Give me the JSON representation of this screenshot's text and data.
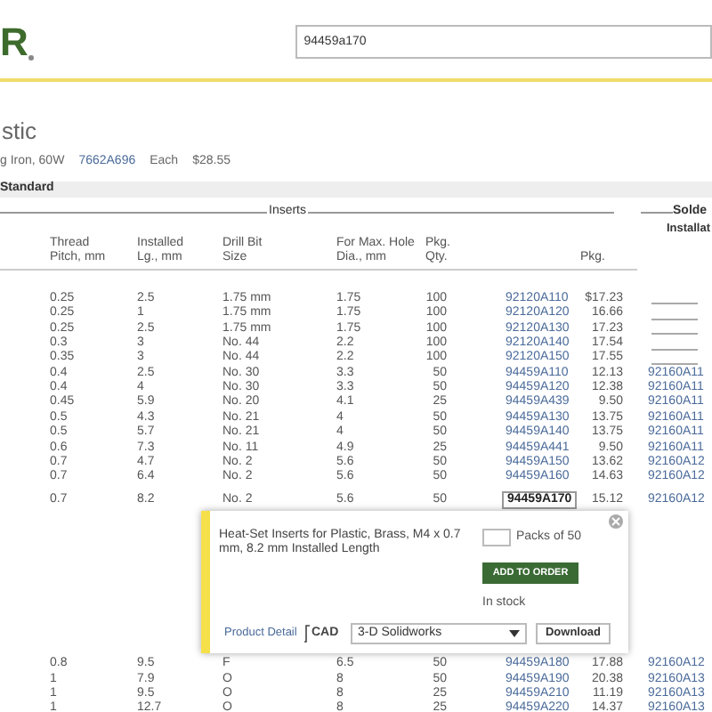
{
  "logo": "R",
  "search": {
    "value": "94459a170"
  },
  "title": "stic",
  "tool": {
    "name": "g Iron, 60W",
    "part": "7662A696",
    "unit": "Each",
    "price": "$28.55"
  },
  "section": "Standard",
  "groups": {
    "inserts": "Inserts",
    "solder": "Solde",
    "solder_sub": "Installat"
  },
  "columns": [
    "Thread Pitch, mm",
    "Installed Lg., mm",
    "Drill Bit Size",
    "For Max. Hole Dia., mm",
    "Pkg. Qty.",
    "",
    "Pkg."
  ],
  "rows": [
    {
      "thread": "0.25",
      "length": "2.5",
      "drill": "1.75 mm",
      "hole": "1.75",
      "qty": "100",
      "part": "92120A110",
      "price": "$17.23",
      "selected": false
    },
    {
      "thread": "0.25",
      "length": "1",
      "drill": "1.75 mm",
      "hole": "1.75",
      "qty": "100",
      "part": "92120A120",
      "price": "16.66",
      "selected": false
    },
    {
      "thread": "0.25",
      "length": "2.5",
      "drill": "1.75 mm",
      "hole": "1.75",
      "qty": "100",
      "part": "92120A130",
      "price": "17.23",
      "selected": false
    },
    {
      "thread": "0.3",
      "length": "3",
      "drill": "No. 44",
      "hole": "2.2",
      "qty": "100",
      "part": "92120A140",
      "price": "17.54",
      "selected": false
    },
    {
      "thread": "0.35",
      "length": "3",
      "drill": "No. 44",
      "hole": "2.2",
      "qty": "100",
      "part": "92120A150",
      "price": "17.55",
      "selected": false
    },
    {
      "thread": "0.4",
      "length": "2.5",
      "drill": "No. 30",
      "hole": "3.3",
      "qty": "50",
      "part": "94459A110",
      "price": "12.13",
      "solder": "92160A11",
      "selected": false
    },
    {
      "thread": "0.4",
      "length": "4",
      "drill": "No. 30",
      "hole": "3.3",
      "qty": "50",
      "part": "94459A120",
      "price": "12.38",
      "solder": "92160A11",
      "selected": false
    },
    {
      "thread": "0.45",
      "length": "5.9",
      "drill": "No. 20",
      "hole": "4.1",
      "qty": "25",
      "part": "94459A439",
      "price": "9.50",
      "solder": "92160A11",
      "selected": false
    },
    {
      "thread": "0.5",
      "length": "4.3",
      "drill": "No. 21",
      "hole": "4",
      "qty": "50",
      "part": "94459A130",
      "price": "13.75",
      "solder": "92160A11",
      "selected": false
    },
    {
      "thread": "0.5",
      "length": "5.7",
      "drill": "No. 21",
      "hole": "4",
      "qty": "50",
      "part": "94459A140",
      "price": "13.75",
      "solder": "92160A11",
      "selected": false
    },
    {
      "thread": "0.6",
      "length": "7.3",
      "drill": "No. 11",
      "hole": "4.9",
      "qty": "25",
      "part": "94459A441",
      "price": "9.50",
      "solder": "92160A11",
      "selected": false
    },
    {
      "thread": "0.7",
      "length": "4.7",
      "drill": "No. 2",
      "hole": "5.6",
      "qty": "50",
      "part": "94459A150",
      "price": "13.62",
      "solder": "92160A12",
      "selected": false
    },
    {
      "thread": "0.7",
      "length": "6.4",
      "drill": "No. 2",
      "hole": "5.6",
      "qty": "50",
      "part": "94459A160",
      "price": "14.63",
      "solder": "92160A12",
      "selected": false
    },
    {
      "thread": "0.7",
      "length": "8.2",
      "drill": "No. 2",
      "hole": "5.6",
      "qty": "50",
      "part": "94459A170",
      "price": "15.12",
      "solder": "92160A12",
      "selected": true
    }
  ],
  "popup": {
    "description": "Heat-Set Inserts for Plastic, Brass, M4 x 0.7 mm, 8.2 mm Installed Length",
    "packs": "Packs of 50",
    "add": "ADD TO ORDER",
    "stock": "In stock",
    "detail": "Product Detail",
    "cad": "CAD",
    "format": "3-D Solidworks",
    "download": "Download"
  },
  "rows_after": [
    {
      "thread": "0.8",
      "length": "9.5",
      "drill": "F",
      "hole": "6.5",
      "qty": "50",
      "part": "94459A180",
      "price": "17.88",
      "solder": "92160A12",
      "selected": false
    },
    {
      "thread": "1",
      "length": "7.9",
      "drill": "O",
      "hole": "8",
      "qty": "50",
      "part": "94459A190",
      "price": "20.38",
      "solder": "92160A13",
      "selected": false
    },
    {
      "thread": "1",
      "length": "9.5",
      "drill": "O",
      "hole": "8",
      "qty": "25",
      "part": "94459A210",
      "price": "11.19",
      "solder": "92160A13",
      "selected": false
    },
    {
      "thread": "1",
      "length": "12.7",
      "drill": "O",
      "hole": "8",
      "qty": "25",
      "part": "94459A220",
      "price": "14.37",
      "solder": "92160A13",
      "selected": false
    }
  ]
}
